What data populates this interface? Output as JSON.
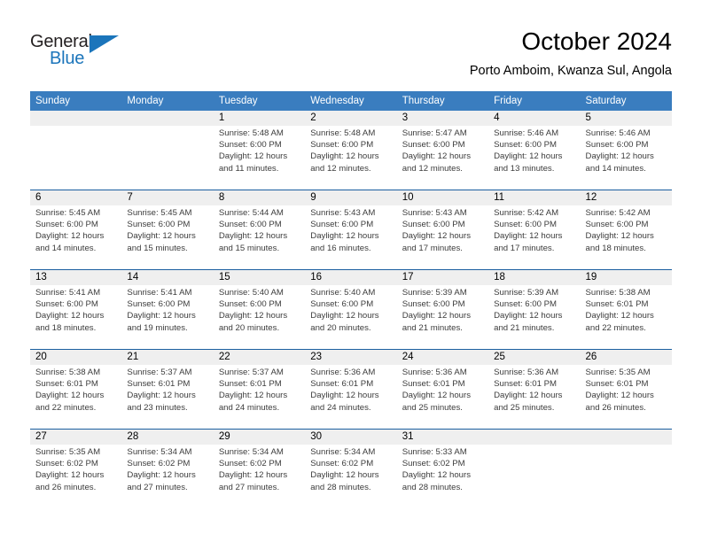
{
  "brand": {
    "name_top": "General",
    "name_bottom": "Blue",
    "color_dark": "#231f20",
    "color_blue": "#1b75bb"
  },
  "header": {
    "title": "October 2024",
    "subtitle": "Porto Amboim, Kwanza Sul, Angola"
  },
  "theme": {
    "header_blue": "#3a7dbf",
    "rule_blue": "#1b5fa0",
    "numbers_band": "#efefef"
  },
  "weekday_headers": [
    "Sunday",
    "Monday",
    "Tuesday",
    "Wednesday",
    "Thursday",
    "Friday",
    "Saturday"
  ],
  "weeks": [
    {
      "days": [
        {
          "num": "",
          "lines": []
        },
        {
          "num": "",
          "lines": []
        },
        {
          "num": "1",
          "lines": [
            "Sunrise: 5:48 AM",
            "Sunset: 6:00 PM",
            "Daylight: 12 hours",
            "and 11 minutes."
          ]
        },
        {
          "num": "2",
          "lines": [
            "Sunrise: 5:48 AM",
            "Sunset: 6:00 PM",
            "Daylight: 12 hours",
            "and 12 minutes."
          ]
        },
        {
          "num": "3",
          "lines": [
            "Sunrise: 5:47 AM",
            "Sunset: 6:00 PM",
            "Daylight: 12 hours",
            "and 12 minutes."
          ]
        },
        {
          "num": "4",
          "lines": [
            "Sunrise: 5:46 AM",
            "Sunset: 6:00 PM",
            "Daylight: 12 hours",
            "and 13 minutes."
          ]
        },
        {
          "num": "5",
          "lines": [
            "Sunrise: 5:46 AM",
            "Sunset: 6:00 PM",
            "Daylight: 12 hours",
            "and 14 minutes."
          ]
        }
      ]
    },
    {
      "days": [
        {
          "num": "6",
          "lines": [
            "Sunrise: 5:45 AM",
            "Sunset: 6:00 PM",
            "Daylight: 12 hours",
            "and 14 minutes."
          ]
        },
        {
          "num": "7",
          "lines": [
            "Sunrise: 5:45 AM",
            "Sunset: 6:00 PM",
            "Daylight: 12 hours",
            "and 15 minutes."
          ]
        },
        {
          "num": "8",
          "lines": [
            "Sunrise: 5:44 AM",
            "Sunset: 6:00 PM",
            "Daylight: 12 hours",
            "and 15 minutes."
          ]
        },
        {
          "num": "9",
          "lines": [
            "Sunrise: 5:43 AM",
            "Sunset: 6:00 PM",
            "Daylight: 12 hours",
            "and 16 minutes."
          ]
        },
        {
          "num": "10",
          "lines": [
            "Sunrise: 5:43 AM",
            "Sunset: 6:00 PM",
            "Daylight: 12 hours",
            "and 17 minutes."
          ]
        },
        {
          "num": "11",
          "lines": [
            "Sunrise: 5:42 AM",
            "Sunset: 6:00 PM",
            "Daylight: 12 hours",
            "and 17 minutes."
          ]
        },
        {
          "num": "12",
          "lines": [
            "Sunrise: 5:42 AM",
            "Sunset: 6:00 PM",
            "Daylight: 12 hours",
            "and 18 minutes."
          ]
        }
      ]
    },
    {
      "days": [
        {
          "num": "13",
          "lines": [
            "Sunrise: 5:41 AM",
            "Sunset: 6:00 PM",
            "Daylight: 12 hours",
            "and 18 minutes."
          ]
        },
        {
          "num": "14",
          "lines": [
            "Sunrise: 5:41 AM",
            "Sunset: 6:00 PM",
            "Daylight: 12 hours",
            "and 19 minutes."
          ]
        },
        {
          "num": "15",
          "lines": [
            "Sunrise: 5:40 AM",
            "Sunset: 6:00 PM",
            "Daylight: 12 hours",
            "and 20 minutes."
          ]
        },
        {
          "num": "16",
          "lines": [
            "Sunrise: 5:40 AM",
            "Sunset: 6:00 PM",
            "Daylight: 12 hours",
            "and 20 minutes."
          ]
        },
        {
          "num": "17",
          "lines": [
            "Sunrise: 5:39 AM",
            "Sunset: 6:00 PM",
            "Daylight: 12 hours",
            "and 21 minutes."
          ]
        },
        {
          "num": "18",
          "lines": [
            "Sunrise: 5:39 AM",
            "Sunset: 6:00 PM",
            "Daylight: 12 hours",
            "and 21 minutes."
          ]
        },
        {
          "num": "19",
          "lines": [
            "Sunrise: 5:38 AM",
            "Sunset: 6:01 PM",
            "Daylight: 12 hours",
            "and 22 minutes."
          ]
        }
      ]
    },
    {
      "days": [
        {
          "num": "20",
          "lines": [
            "Sunrise: 5:38 AM",
            "Sunset: 6:01 PM",
            "Daylight: 12 hours",
            "and 22 minutes."
          ]
        },
        {
          "num": "21",
          "lines": [
            "Sunrise: 5:37 AM",
            "Sunset: 6:01 PM",
            "Daylight: 12 hours",
            "and 23 minutes."
          ]
        },
        {
          "num": "22",
          "lines": [
            "Sunrise: 5:37 AM",
            "Sunset: 6:01 PM",
            "Daylight: 12 hours",
            "and 24 minutes."
          ]
        },
        {
          "num": "23",
          "lines": [
            "Sunrise: 5:36 AM",
            "Sunset: 6:01 PM",
            "Daylight: 12 hours",
            "and 24 minutes."
          ]
        },
        {
          "num": "24",
          "lines": [
            "Sunrise: 5:36 AM",
            "Sunset: 6:01 PM",
            "Daylight: 12 hours",
            "and 25 minutes."
          ]
        },
        {
          "num": "25",
          "lines": [
            "Sunrise: 5:36 AM",
            "Sunset: 6:01 PM",
            "Daylight: 12 hours",
            "and 25 minutes."
          ]
        },
        {
          "num": "26",
          "lines": [
            "Sunrise: 5:35 AM",
            "Sunset: 6:01 PM",
            "Daylight: 12 hours",
            "and 26 minutes."
          ]
        }
      ]
    },
    {
      "days": [
        {
          "num": "27",
          "lines": [
            "Sunrise: 5:35 AM",
            "Sunset: 6:02 PM",
            "Daylight: 12 hours",
            "and 26 minutes."
          ]
        },
        {
          "num": "28",
          "lines": [
            "Sunrise: 5:34 AM",
            "Sunset: 6:02 PM",
            "Daylight: 12 hours",
            "and 27 minutes."
          ]
        },
        {
          "num": "29",
          "lines": [
            "Sunrise: 5:34 AM",
            "Sunset: 6:02 PM",
            "Daylight: 12 hours",
            "and 27 minutes."
          ]
        },
        {
          "num": "30",
          "lines": [
            "Sunrise: 5:34 AM",
            "Sunset: 6:02 PM",
            "Daylight: 12 hours",
            "and 28 minutes."
          ]
        },
        {
          "num": "31",
          "lines": [
            "Sunrise: 5:33 AM",
            "Sunset: 6:02 PM",
            "Daylight: 12 hours",
            "and 28 minutes."
          ]
        },
        {
          "num": "",
          "lines": []
        },
        {
          "num": "",
          "lines": []
        }
      ]
    }
  ]
}
